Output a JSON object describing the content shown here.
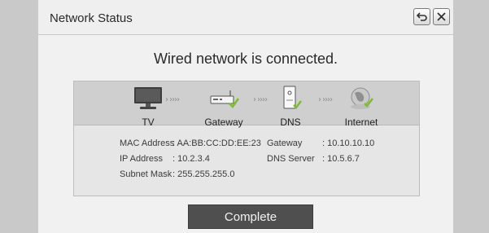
{
  "dialog": {
    "title": "Network Status",
    "headline": "Wired network is connected.",
    "return_icon": "return-icon",
    "close_icon": "close-icon"
  },
  "connection_path": {
    "nodes": [
      {
        "label": "TV",
        "icon": "tv-icon"
      },
      {
        "label": "Gateway",
        "icon": "gateway-icon"
      },
      {
        "label": "DNS",
        "icon": "dns-server-icon"
      },
      {
        "label": "Internet",
        "icon": "globe-icon"
      }
    ],
    "connector": "›  ›››› "
  },
  "network_info": {
    "mac_address": {
      "label": "MAC Address",
      "value": ": AA:BB:CC:DD:EE:23"
    },
    "ip_address": {
      "label": "IP Address",
      "value": ": 10.2.3.4"
    },
    "subnet_mask": {
      "label": "Subnet Mask",
      "value": ": 255.255.255.0"
    },
    "gateway": {
      "label": "Gateway",
      "value": ": 10.10.10.10"
    },
    "dns_server": {
      "label": "DNS Server",
      "value": ": 10.5.6.7"
    }
  },
  "actions": {
    "complete_label": "Complete"
  },
  "colors": {
    "check_green": "#7bbf2a",
    "button_dark": "#4f4f4f"
  }
}
